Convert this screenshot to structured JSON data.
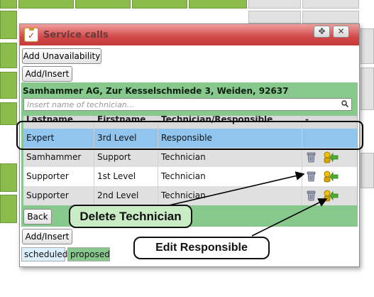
{
  "dialog": {
    "title": "Service calls",
    "add_unavailability": "Add Unavailability",
    "add_insert_top": "Add/Insert",
    "address": "Samhammer AG, Zur Kesselschmiede 3, Weiden, 92637",
    "search_placeholder": "Insert name of technician...",
    "columns": [
      "Lastname",
      "Firstname",
      "Technician/Responsible",
      "-"
    ],
    "rows": [
      {
        "lastname": "Expert",
        "firstname": "3rd Level",
        "role": "Responsible"
      },
      {
        "lastname": "Samhammer",
        "firstname": "Support",
        "role": "Technician"
      },
      {
        "lastname": "Supporter",
        "firstname": "1st Level",
        "role": "Technician"
      },
      {
        "lastname": "Supporter",
        "firstname": "2nd Level",
        "role": "Technician"
      }
    ],
    "back": "Back",
    "add_insert_bottom": "Add/Insert",
    "legend": [
      "scheduled",
      "proposed"
    ]
  },
  "annotations": {
    "delete": "Delete Technician",
    "edit": "Edit Responsible"
  },
  "colors": {
    "title_bar": "#d24848",
    "panel_green": "#87c98d",
    "selected_row": "#8fc5ef",
    "calendar_green": "#8cbc4c"
  },
  "icons": [
    "title-clipboard-icon",
    "maximize-icon",
    "close-icon",
    "search-icon",
    "trash-icon",
    "edit-responsible-icon"
  ]
}
